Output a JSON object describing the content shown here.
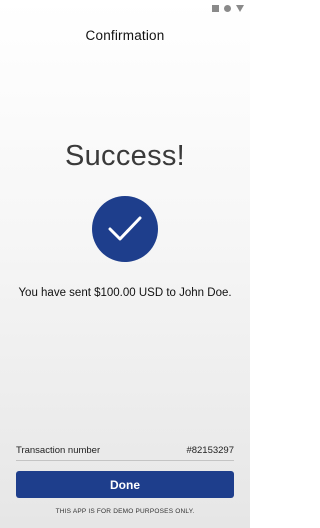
{
  "header": {
    "title": "Confirmation"
  },
  "main": {
    "heading": "Success!",
    "message": "You have sent $100.00 USD to John Doe."
  },
  "transaction": {
    "label": "Transaction number",
    "number": "#82153297"
  },
  "actions": {
    "done_label": "Done"
  },
  "footer": {
    "disclaimer": "THIS APP IS FOR DEMO PURPOSES ONLY."
  },
  "icons": {
    "status_square": "square-icon",
    "status_circle": "circle-icon",
    "status_triangle": "triangle-icon",
    "check": "checkmark-icon"
  },
  "colors": {
    "brand": "#1e3e8c",
    "background_top": "#ffffff",
    "background_bottom": "#e6e6e6"
  }
}
